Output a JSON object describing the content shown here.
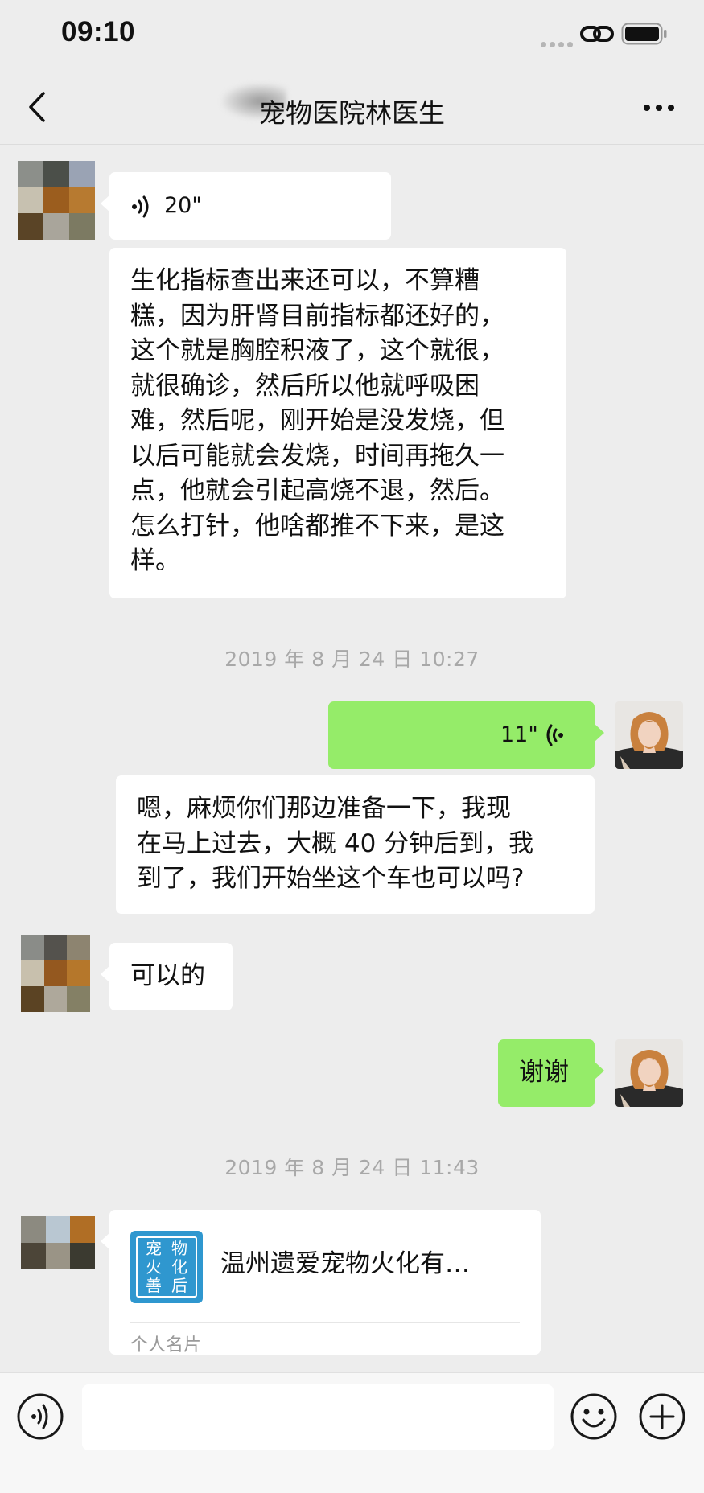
{
  "status_bar": {
    "time": "09:10",
    "icons": [
      "signal-dots-icon",
      "link-icon",
      "battery-icon"
    ]
  },
  "header": {
    "title": "宠物医院林医生",
    "back_icon": "chevron-left-icon",
    "more_icon": "more-dots-icon"
  },
  "messages": [
    {
      "sender": "contact",
      "type": "voice",
      "duration": "20\""
    },
    {
      "sender": "contact",
      "type": "text",
      "lines": [
        "生化指标查出来还可以，不算糟",
        "糕，因为肝肾目前指标都还好的，",
        "这个就是胸腔积液了，这个就很，",
        "就很确诊，然后所以他就呼吸困",
        "难，然后呢，刚开始是没发烧，但",
        "以后可能就会发烧，时间再拖久一",
        "点，他就会引起高烧不退，然后。",
        "怎么打针，他啥都推不下来，是这",
        "样。"
      ]
    },
    {
      "type": "timestamp",
      "text": "2019 年 8 月 24 日 10:27"
    },
    {
      "sender": "me",
      "type": "voice",
      "duration": "11\""
    },
    {
      "sender": "me",
      "type": "text",
      "lines": [
        "嗯，麻烦你们那边准备一下，我现",
        "在马上过去，大概 40 分钟后到，我",
        "到了，我们开始坐这个车也可以吗?"
      ]
    },
    {
      "sender": "contact",
      "type": "text",
      "lines": [
        "可以的"
      ]
    },
    {
      "sender": "me",
      "type": "text",
      "lines": [
        "谢谢"
      ]
    },
    {
      "type": "timestamp",
      "text": "2019 年 8 月 24 日 11:43"
    },
    {
      "sender": "contact",
      "type": "contact_card",
      "name": "温州遗爱宠物火化有…",
      "logo_chars": [
        "宠",
        "物",
        "火",
        "化",
        "善",
        "后"
      ],
      "card_type": "个人名片"
    }
  ],
  "input_bar": {
    "voice_icon": "voice-input-icon",
    "placeholder": "",
    "emoji_icon": "emoji-icon",
    "plus_icon": "plus-icon"
  },
  "colors": {
    "background": "#ededed",
    "my_bubble": "#95ec69",
    "their_bubble": "#ffffff",
    "card_logo": "#2f97cf",
    "timestamp_text": "#a8a8a8"
  }
}
